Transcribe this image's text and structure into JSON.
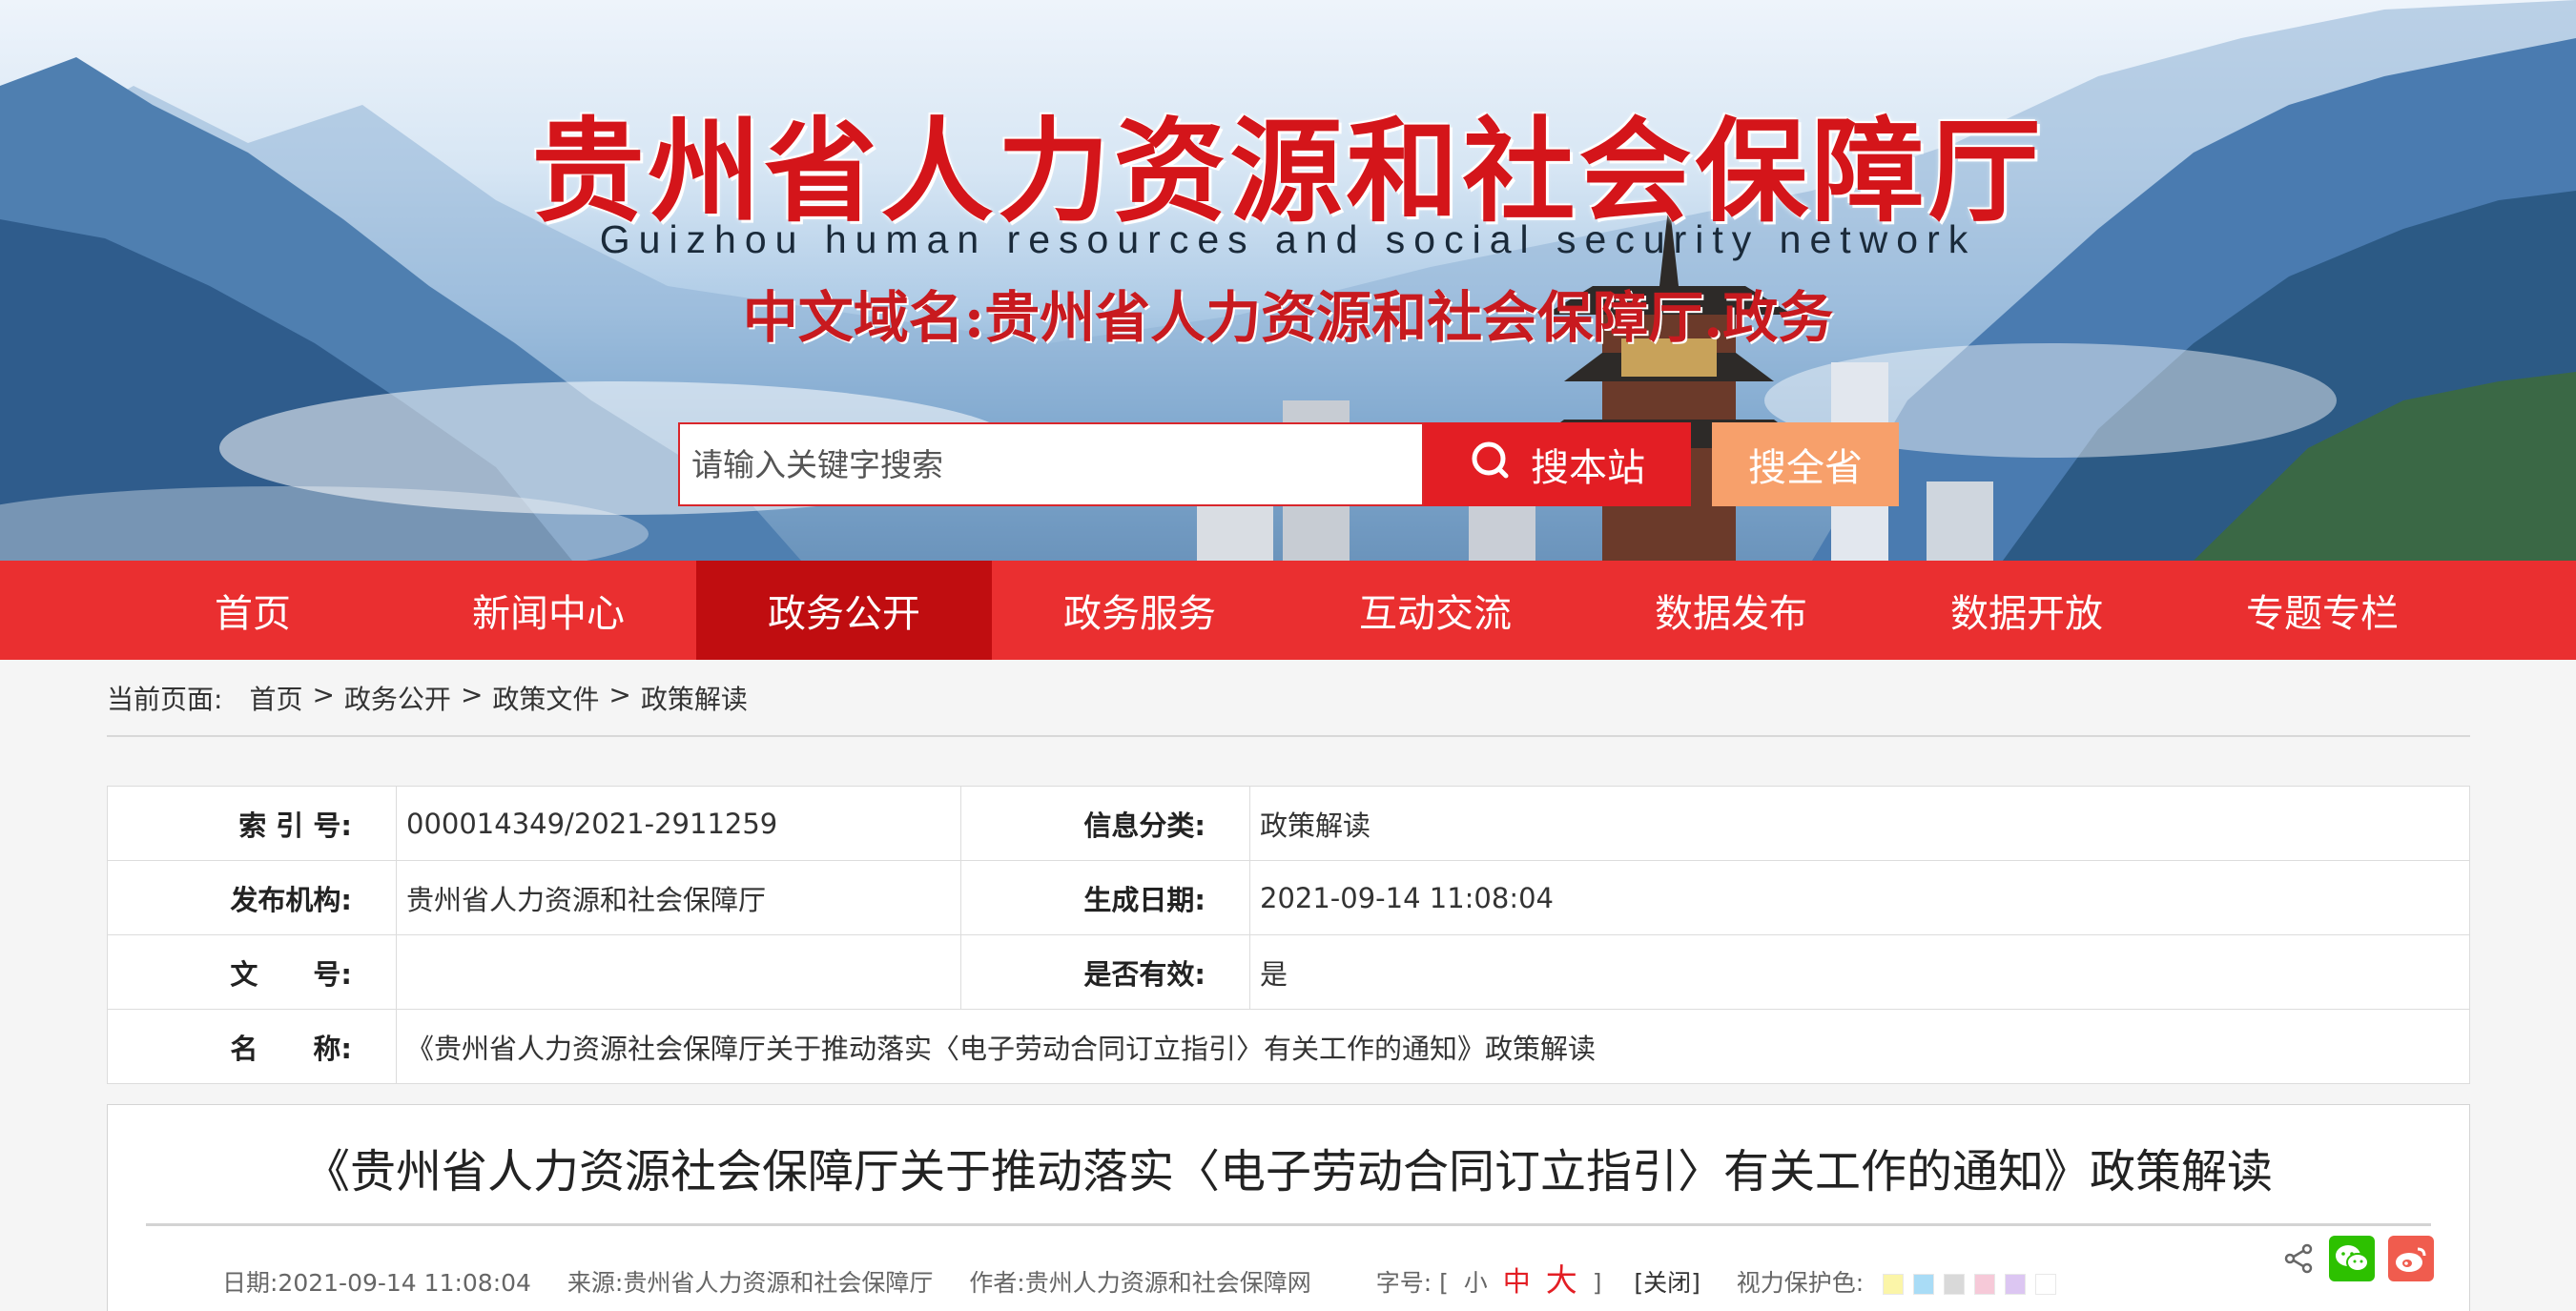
{
  "header": {
    "title_cn": "贵州省人力资源和社会保障厅",
    "title_en": "Guizhou human resources and social security network",
    "domain_line": "中文域名:贵州省人力资源和社会保障厅.政务"
  },
  "search": {
    "placeholder": "请输入关键字搜索",
    "site_button": "搜本站",
    "province_button": "搜全省"
  },
  "nav": {
    "items": [
      "首页",
      "新闻中心",
      "政务公开",
      "政务服务",
      "互动交流",
      "数据发布",
      "数据开放",
      "专题专栏"
    ],
    "active": "政务公开"
  },
  "breadcrumb": {
    "label": "当前页面:",
    "items": [
      "首页",
      "政务公开",
      "政策文件",
      "政策解读"
    ],
    "separator": ">"
  },
  "info": {
    "index_label": "索 引 号:",
    "index_value": "000014349/2021-2911259",
    "category_label": "信息分类:",
    "category_value": "政策解读",
    "publisher_label": "发布机构:",
    "publisher_value": "贵州省人力资源和社会保障厅",
    "date_label": "生成日期:",
    "date_value": "2021-09-14 11:08:04",
    "docno_label": "文　　号:",
    "docno_value": "",
    "valid_label": "是否有效:",
    "valid_value": "是",
    "name_label": "名　　称:",
    "name_value": "《贵州省人力资源社会保障厅关于推动落实〈电子劳动合同订立指引〉有关工作的通知》政策解读"
  },
  "article": {
    "title": "《贵州省人力资源社会保障厅关于推动落实〈电子劳动合同订立指引〉有关工作的通知》政策解读",
    "date_text": "日期:2021-09-14 11:08:04",
    "source_text": "来源:贵州省人力资源和社会保障厅",
    "author_text": "作者:贵州人力资源和社会保障网",
    "fontsize_label": "字号:",
    "fontsize_open": "[",
    "fs_small": "小",
    "fs_mid": "中",
    "fs_big": "大",
    "fontsize_close": "]",
    "close_text": "[关闭]",
    "eye_label": "视力保护色:",
    "swatches": [
      "#fbf5a8",
      "#a9dcf6",
      "#d9d9d9",
      "#f6c9d8",
      "#dcc6f2",
      "#ffffff"
    ]
  },
  "icons": {
    "search": "search-icon",
    "share": "share-icon",
    "wechat": "wechat-icon",
    "weibo": "weibo-icon"
  },
  "colors": {
    "brand_red": "#e31e24",
    "nav_bg": "#ea2f30",
    "nav_active": "#c00d10",
    "province_btn": "#f7a06b",
    "wechat_green": "#2dc100",
    "weibo_red": "#e6162d"
  }
}
